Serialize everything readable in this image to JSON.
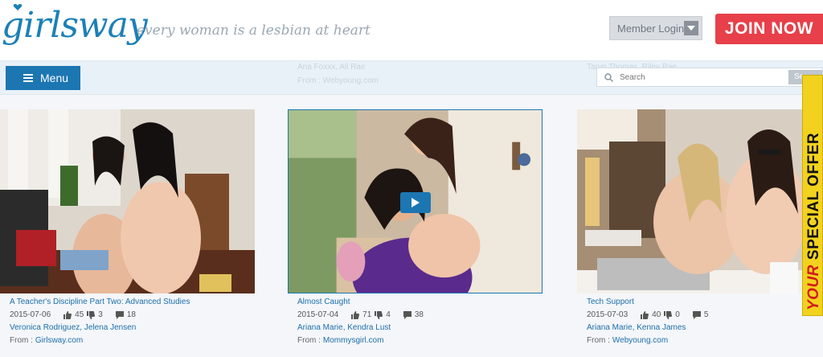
{
  "header": {
    "logo": "girlsway",
    "tagline": "every woman is a lesbian at heart",
    "login_label": "Member Login",
    "join_label": "JOIN NOW"
  },
  "nav": {
    "menu_label": "Menu",
    "search_placeholder": "Search",
    "search_button": "Se",
    "ghost_text": {
      "col2_names": "Ana Foxxx, Ali Rae",
      "col2_from": "From : Webyoung.com",
      "col3_names": "Taryn Thomas, Riley Rae"
    }
  },
  "offer": {
    "your": "YOUR",
    "special": "SPECIAL OFFER"
  },
  "colors": {
    "accent": "#1c76b2",
    "join": "#e8404a",
    "offer": "#f2d21e"
  },
  "cards": [
    {
      "title": "A Teacher's Discipline Part Two: Advanced Studies",
      "date": "2015-07-06",
      "likes": "45",
      "dislikes": "3",
      "comments": "18",
      "actors": "Veronica Rodriguez, Jelena Jensen",
      "from_label": "From :",
      "site": "Girlsway.com"
    },
    {
      "title": "Almost Caught",
      "date": "2015-07-04",
      "likes": "71",
      "dislikes": "4",
      "comments": "38",
      "actors": "Ariana Marie, Kendra Lust",
      "from_label": "From :",
      "site": "Mommysgirl.com"
    },
    {
      "title": "Tech Support",
      "date": "2015-07-03",
      "likes": "40",
      "dislikes": "0",
      "comments": "5",
      "actors": "Ariana Marie, Kenna James",
      "from_label": "From :",
      "site": "Webyoung.com"
    }
  ]
}
